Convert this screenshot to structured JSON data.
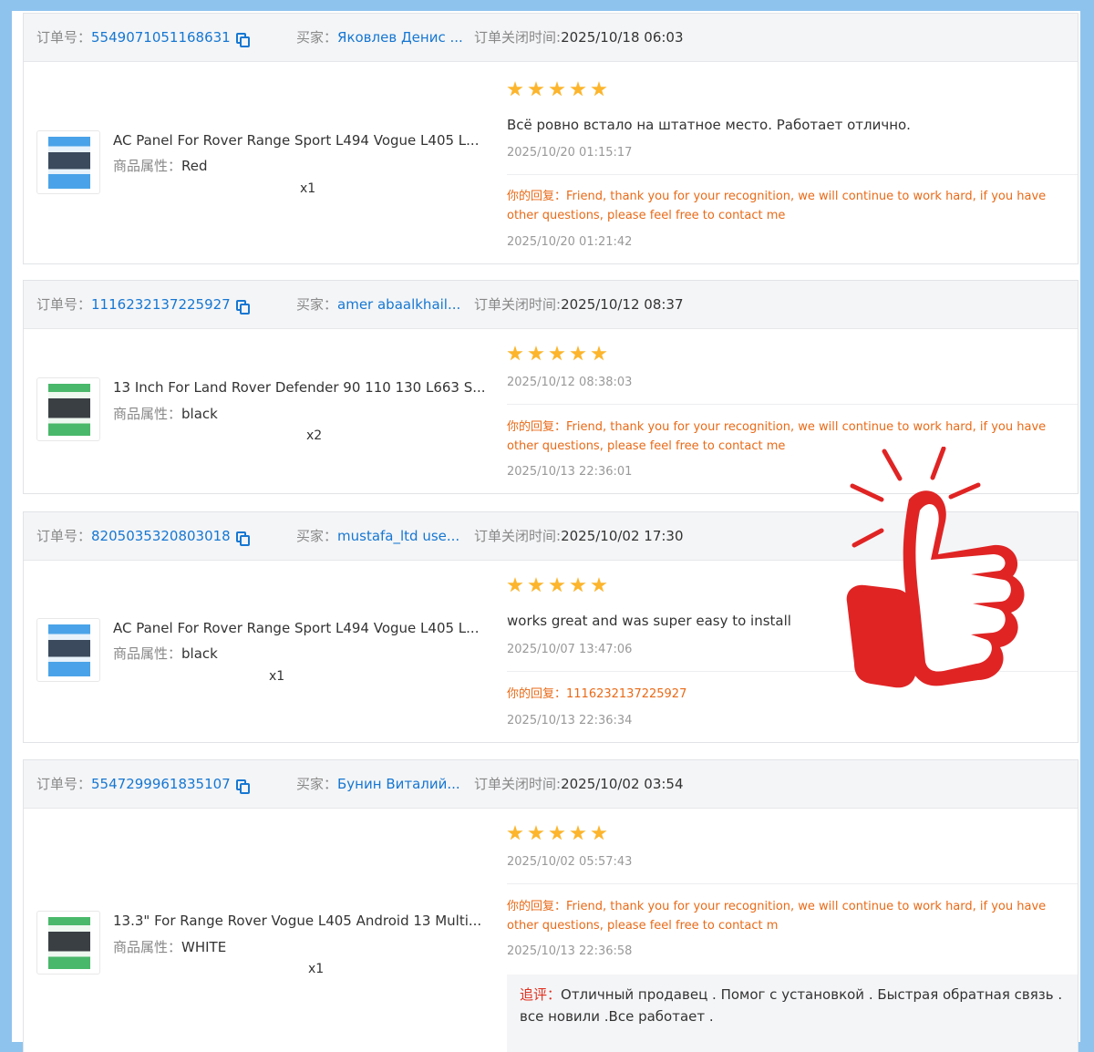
{
  "labels": {
    "order_no": "订单号：",
    "buyer": "买家：",
    "closed_time": "订单关闭时间:",
    "attr": "商品属性：",
    "reply": "你的回复：",
    "followup": "追评："
  },
  "colors": {
    "accent": "#1677d2",
    "star": "#fcb52c",
    "reply": "#e96a17",
    "followup_label": "#e0301e",
    "thumbs_up": "#e02424",
    "background": "#8ec3ee"
  },
  "orders": [
    {
      "order_id": "5549071051168631",
      "buyer": "Яковлев Денис ...",
      "closed_time": "2025/10/18 06:03",
      "product_name": "AC Panel For Rover Range Sport L494 Vogue L405 L...",
      "attr": "Red",
      "qty": "x1",
      "rating": 5,
      "review": "Всё ровно встало на штатное место. Работает отлично.",
      "review_date": "2025/10/20 01:15:17",
      "reply": "Friend, thank you for your recognition, we will continue to work hard, if you have other questions, please feel free to contact me",
      "reply_date": "2025/10/20 01:21:42"
    },
    {
      "order_id": "1116232137225927",
      "buyer": "amer abaalkhail...",
      "closed_time": "2025/10/12 08:37",
      "product_name": "13 Inch For Land Rover Defender 90 110 130 L663 S...",
      "attr": "black",
      "qty": "x2",
      "rating": 5,
      "review": "",
      "review_date": "2025/10/12 08:38:03",
      "reply": "Friend, thank you for your recognition, we will continue to work hard, if you have other questions, please feel free to contact me",
      "reply_date": "2025/10/13 22:36:01"
    },
    {
      "order_id": "8205035320803018",
      "buyer": "mustafa_ltd use...",
      "closed_time": "2025/10/02 17:30",
      "product_name": "AC Panel For Rover Range Sport L494 Vogue L405 L...",
      "attr": "black",
      "qty": "x1",
      "rating": 5,
      "review": "works great and was super easy to install",
      "review_date": "2025/10/07 13:47:06",
      "reply": "1116232137225927",
      "reply_date": "2025/10/13 22:36:34"
    },
    {
      "order_id": "5547299961835107",
      "buyer": "Бунин Виталий...",
      "closed_time": "2025/10/02 03:54",
      "product_name": "13.3\" For Range Rover Vogue L405 Android 13 Multi...",
      "attr": "WHITE",
      "qty": "x1",
      "rating": 5,
      "review": "",
      "review_date": "2025/10/02 05:57:43",
      "reply": "Friend, thank you for your recognition, we will continue to work hard, if you have other questions, please feel free to contact m",
      "reply_date": "2025/10/13 22:36:58",
      "followup": "Отличный продавец . Помог с установкой . Быстрая обратная связь . все новили .Все работает ."
    }
  ]
}
